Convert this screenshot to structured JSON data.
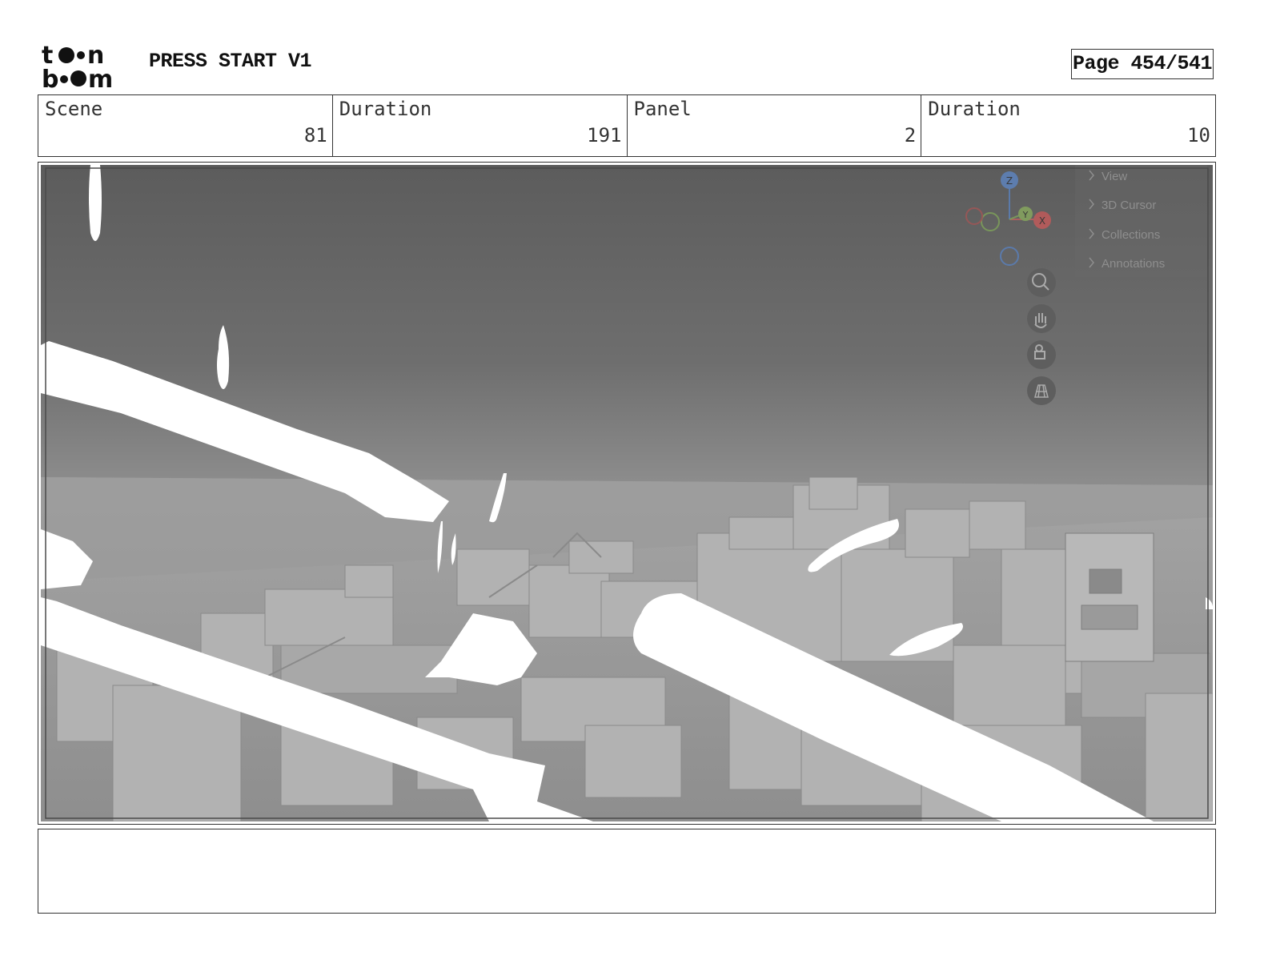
{
  "header": {
    "logo_top": "to•n",
    "logo_bottom": "b••m",
    "project_title": "PRESS START V1",
    "page_label": "Page 454/541"
  },
  "info": {
    "scene_label": "Scene",
    "scene_value": "81",
    "scene_duration_label": "Duration",
    "scene_duration_value": "191",
    "panel_label": "Panel",
    "panel_value": "2",
    "panel_duration_label": "Duration",
    "panel_duration_value": "10"
  },
  "viewport": {
    "menu_items": [
      "View",
      "3D Cursor",
      "Collections",
      "Annotations"
    ],
    "gizmo_labels": {
      "z": "Z",
      "y": "Y",
      "x": "X"
    },
    "tool_icons": [
      "zoom-icon",
      "hand-pan-icon",
      "camera-icon",
      "grid-perspective-icon"
    ]
  },
  "caption": {
    "text": ""
  }
}
